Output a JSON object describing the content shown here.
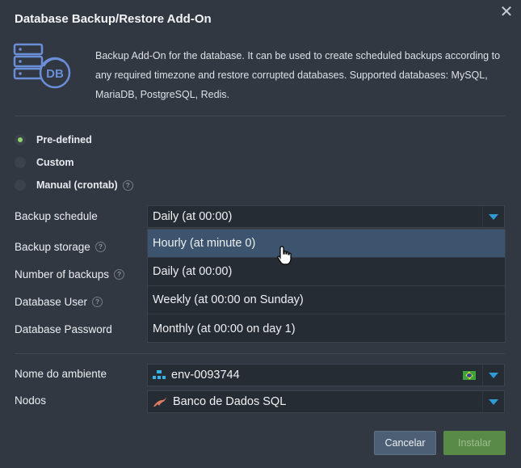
{
  "dialog": {
    "title": "Database Backup/Restore Add-On",
    "description": "Backup Add-On for the database. It can be used to create scheduled backups according to any required timezone and restore corrupted databases. Supported databases: MySQL, MariaDB, PostgreSQL, Redis.",
    "logo_text": "DB"
  },
  "schedule_modes": [
    {
      "label": "Pre-defined",
      "selected": true
    },
    {
      "label": "Custom",
      "selected": false
    },
    {
      "label": "Manual (crontab)",
      "selected": false
    }
  ],
  "fields": {
    "backup_schedule": "Backup schedule",
    "backup_storage": "Backup storage",
    "number_of_backups": "Number of backups",
    "database_user": "Database User",
    "database_password": "Database Password",
    "environment": "Nome do ambiente",
    "nodes": "Nodos"
  },
  "backup_schedule": {
    "value": "Daily (at 00:00)",
    "options": [
      "Hourly (at minute 0)",
      "Daily (at 00:00)",
      "Weekly (at 00:00 on Sunday)",
      "Monthly (at 00:00 on day 1)"
    ],
    "highlighted_option": 0
  },
  "environment": {
    "value": "env-0093744",
    "region_flag": "brazil-flag-icon"
  },
  "nodes": {
    "value": "Banco de Dados SQL"
  },
  "buttons": {
    "cancel": "Cancelar",
    "install": "Instalar"
  },
  "colors": {
    "accent": "#2f9ad6",
    "install": "#5a8a48",
    "selected_radio": "#8fd36d",
    "highlight": "#3c546d"
  }
}
